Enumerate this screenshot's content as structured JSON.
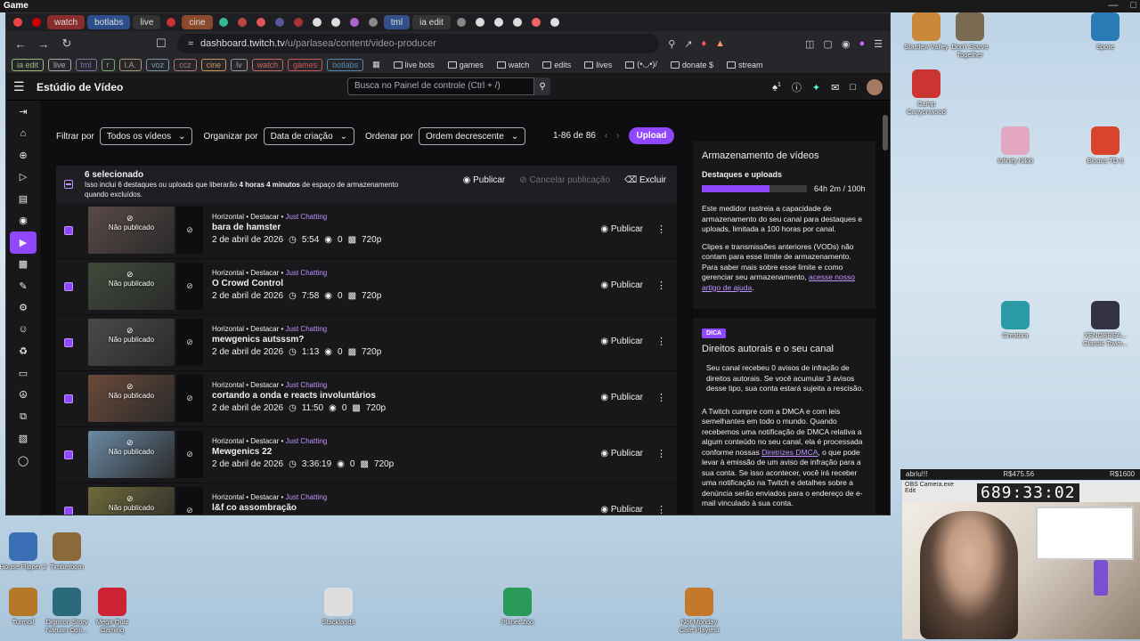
{
  "window_title": "Game",
  "tabs": [
    {
      "label": "",
      "color": "#e44"
    },
    {
      "label": "",
      "color": "#c00"
    },
    {
      "label": "watch",
      "color": "#8b2c2c"
    },
    {
      "label": "botlabs",
      "color": "#2c4f8b"
    },
    {
      "label": "live",
      "color": "#333"
    },
    {
      "label": "",
      "color": "#c33"
    },
    {
      "label": "cine",
      "color": "#8b4a2c"
    },
    {
      "label": "",
      "color": "#3b9"
    },
    {
      "label": "",
      "color": "#b44"
    },
    {
      "label": "",
      "color": "#d55"
    },
    {
      "label": "",
      "color": "#559"
    },
    {
      "label": "",
      "color": "#a33"
    },
    {
      "label": "",
      "color": "#ddd"
    },
    {
      "label": "",
      "color": "#ddd"
    },
    {
      "label": "",
      "color": "#a6c"
    },
    {
      "label": "",
      "color": "#888"
    },
    {
      "label": "tml",
      "color": "#33508b"
    },
    {
      "label": "ia edit",
      "color": "#333"
    },
    {
      "label": "",
      "color": "#888"
    },
    {
      "label": "",
      "color": "#ddd"
    },
    {
      "label": "",
      "color": "#ddd"
    },
    {
      "label": "",
      "color": "#ddd"
    },
    {
      "label": "",
      "color": "#e66"
    },
    {
      "label": "",
      "color": "#ddd"
    }
  ],
  "address_bar": {
    "url_domain": "dashboard.twitch.tv",
    "url_path": "/u/parlasea/content/video-producer"
  },
  "bookmarks": [
    {
      "label": "ia edit",
      "color": "#9b7"
    },
    {
      "label": "live",
      "color": "#aaa"
    },
    {
      "label": "tml",
      "color": "#77a"
    },
    {
      "label": "r",
      "color": "#7a7"
    },
    {
      "label": "I.A.",
      "color": "#a97"
    },
    {
      "label": "voz",
      "color": "#79a"
    },
    {
      "label": "ccz",
      "color": "#a77"
    },
    {
      "label": "cine",
      "color": "#c95"
    },
    {
      "label": "lv",
      "color": "#999"
    },
    {
      "label": "watch",
      "color": "#c66"
    },
    {
      "label": "games",
      "color": "#c55"
    },
    {
      "label": "botlabs",
      "color": "#58a"
    }
  ],
  "bookmark_folders": [
    "live bots",
    "games",
    "watch",
    "edits",
    "lives",
    "(•◡•)/",
    "donate $",
    "stream"
  ],
  "header": {
    "title": "Estúdio de Vídeo",
    "search_placeholder": "Busca no Painel de controle (Ctrl + /)",
    "notif_count": "1"
  },
  "filters": {
    "filter_label": "Filtrar por",
    "filter_value": "Todos os vídeos",
    "organize_label": "Organizar por",
    "organize_value": "Data de criação",
    "order_label": "Ordenar por",
    "order_value": "Ordem decrescente",
    "pager": "1-86 de 86",
    "upload": "Upload"
  },
  "bulk": {
    "count": "6 selecionado",
    "desc_a": "Isso inclui 6 destaques ou uploads que liberarão ",
    "desc_b": "4 horas 4 minutos",
    "desc_c": " de espaço de armazenamento quando excluídos.",
    "publish": "Publicar",
    "cancel": "Cancelar publicação",
    "delete": "Excluir"
  },
  "row_labels": {
    "unpublished": "Não publicado",
    "meta_prefix": "Horizontal • Destacar • ",
    "publish": "Publicar"
  },
  "videos": [
    {
      "title": "bara de hamster",
      "game": "Just Chatting",
      "date": "2 de abril de 2026",
      "duration": "5:54",
      "views": "0",
      "quality": "720p",
      "thumb": "#5a4a48"
    },
    {
      "title": "O Crowd Control",
      "game": "Just Chatting",
      "date": "2 de abril de 2026",
      "duration": "7:58",
      "views": "0",
      "quality": "720p",
      "thumb": "#3f4a3a"
    },
    {
      "title": "mewgenics autsssm?",
      "game": "Just Chatting",
      "date": "2 de abril de 2026",
      "duration": "1:13",
      "views": "0",
      "quality": "720p",
      "thumb": "#4a4a4a"
    },
    {
      "title": "cortando a onda e reacts involuntários",
      "game": "Just Chatting",
      "date": "2 de abril de 2026",
      "duration": "11:50",
      "views": "0",
      "quality": "720p",
      "thumb": "#6b4a3a"
    },
    {
      "title": "Mewgenics 22",
      "game": "Just Chatting",
      "date": "2 de abril de 2026",
      "duration": "3:36:19",
      "views": "0",
      "quality": "720p",
      "thumb": "#6a8aa5"
    },
    {
      "title": "l&f co assombração",
      "game": "Just Chatting",
      "date": "2 de abril de 2026",
      "duration": "1:25",
      "views": "0",
      "quality": "720p",
      "thumb": "#6e6a3a"
    }
  ],
  "storage_card": {
    "title": "Armazenamento de vídeos",
    "label": "Destaques e uploads",
    "value": "64h 2m / 100h",
    "fill_percent": 64,
    "p1": "Este medidor rastreia a capacidade de armazenamento do seu canal para destaques e uploads, limitada a 100 horas por canal.",
    "p2": "Clipes e transmissões anteriores (VODs) não contam para esse limite de armazenamento. Para saber mais sobre esse limite e como gerenciar seu armazenamento, ",
    "p2_link": "acesse nosso artigo de ajuda",
    "p2_end": "."
  },
  "dmca_card": {
    "badge": "DICA",
    "title": "Direitos autorais e o seu canal",
    "p1": "Seu canal recebeu 0 avisos de infração de direitos autorais. Se você acumular 3 avisos desse tipo, sua conta estará sujeita a rescisão.",
    "p2": "A Twitch cumpre com a DMCA e com leis semelhantes em todo o mundo. Quando recebemos uma notificação de DMCA relativa a algum conteúdo no seu canal, ela é processada conforme nossas ",
    "p2_link": "Diretrizes DMCA",
    "p2_end": ", o que pode levar à emissão de um aviso de infração para a sua conta. Se isso acontecer, você irá receber uma notificação na Twitch e detalhes sobre a denúncia serão enviados para o endereço de e-mail vinculado à sua conta."
  },
  "desktop_icons": [
    {
      "label": "Stardew Valley",
      "color": "#c9873a"
    },
    {
      "label": "Don't Starve Together",
      "color": "#7a6a52"
    },
    {
      "label": "Spore",
      "color": "#2a7ab5"
    },
    {
      "label": "Camp Canyonwood",
      "color": "#c33"
    },
    {
      "label": "Infinity Nikki",
      "color": "#e4a8c2"
    },
    {
      "label": "Bloons TD 6",
      "color": "#d8452b"
    },
    {
      "label": "Creatura",
      "color": "#2a9aa5"
    },
    {
      "label": "XENOBREA... Classic Town...",
      "color": "#334"
    },
    {
      "label": "House Flipper 2",
      "color": "#3a6fb5"
    },
    {
      "label": "Timberborn",
      "color": "#8a6a3a"
    },
    {
      "label": "Turmoil",
      "color": "#b5782a"
    },
    {
      "label": "Digimon Story Naruan Opti...",
      "color": "#2a6a7a"
    },
    {
      "label": "Mega Quiz Gaming",
      "color": "#c23"
    },
    {
      "label": "Stacklands",
      "color": "#ddd"
    },
    {
      "label": "Planet Zoo",
      "color": "#2a9a5a"
    },
    {
      "label": "Not Monday Cafe Playtest",
      "color": "#c4782a"
    }
  ],
  "overlay": {
    "left_text": "abriu!!!",
    "mid_text": "R$475.56",
    "right_text": "R$1600",
    "cam_title": "OBS Camera.exe",
    "cam_menu": "Edit",
    "timer": "689:33:02"
  }
}
